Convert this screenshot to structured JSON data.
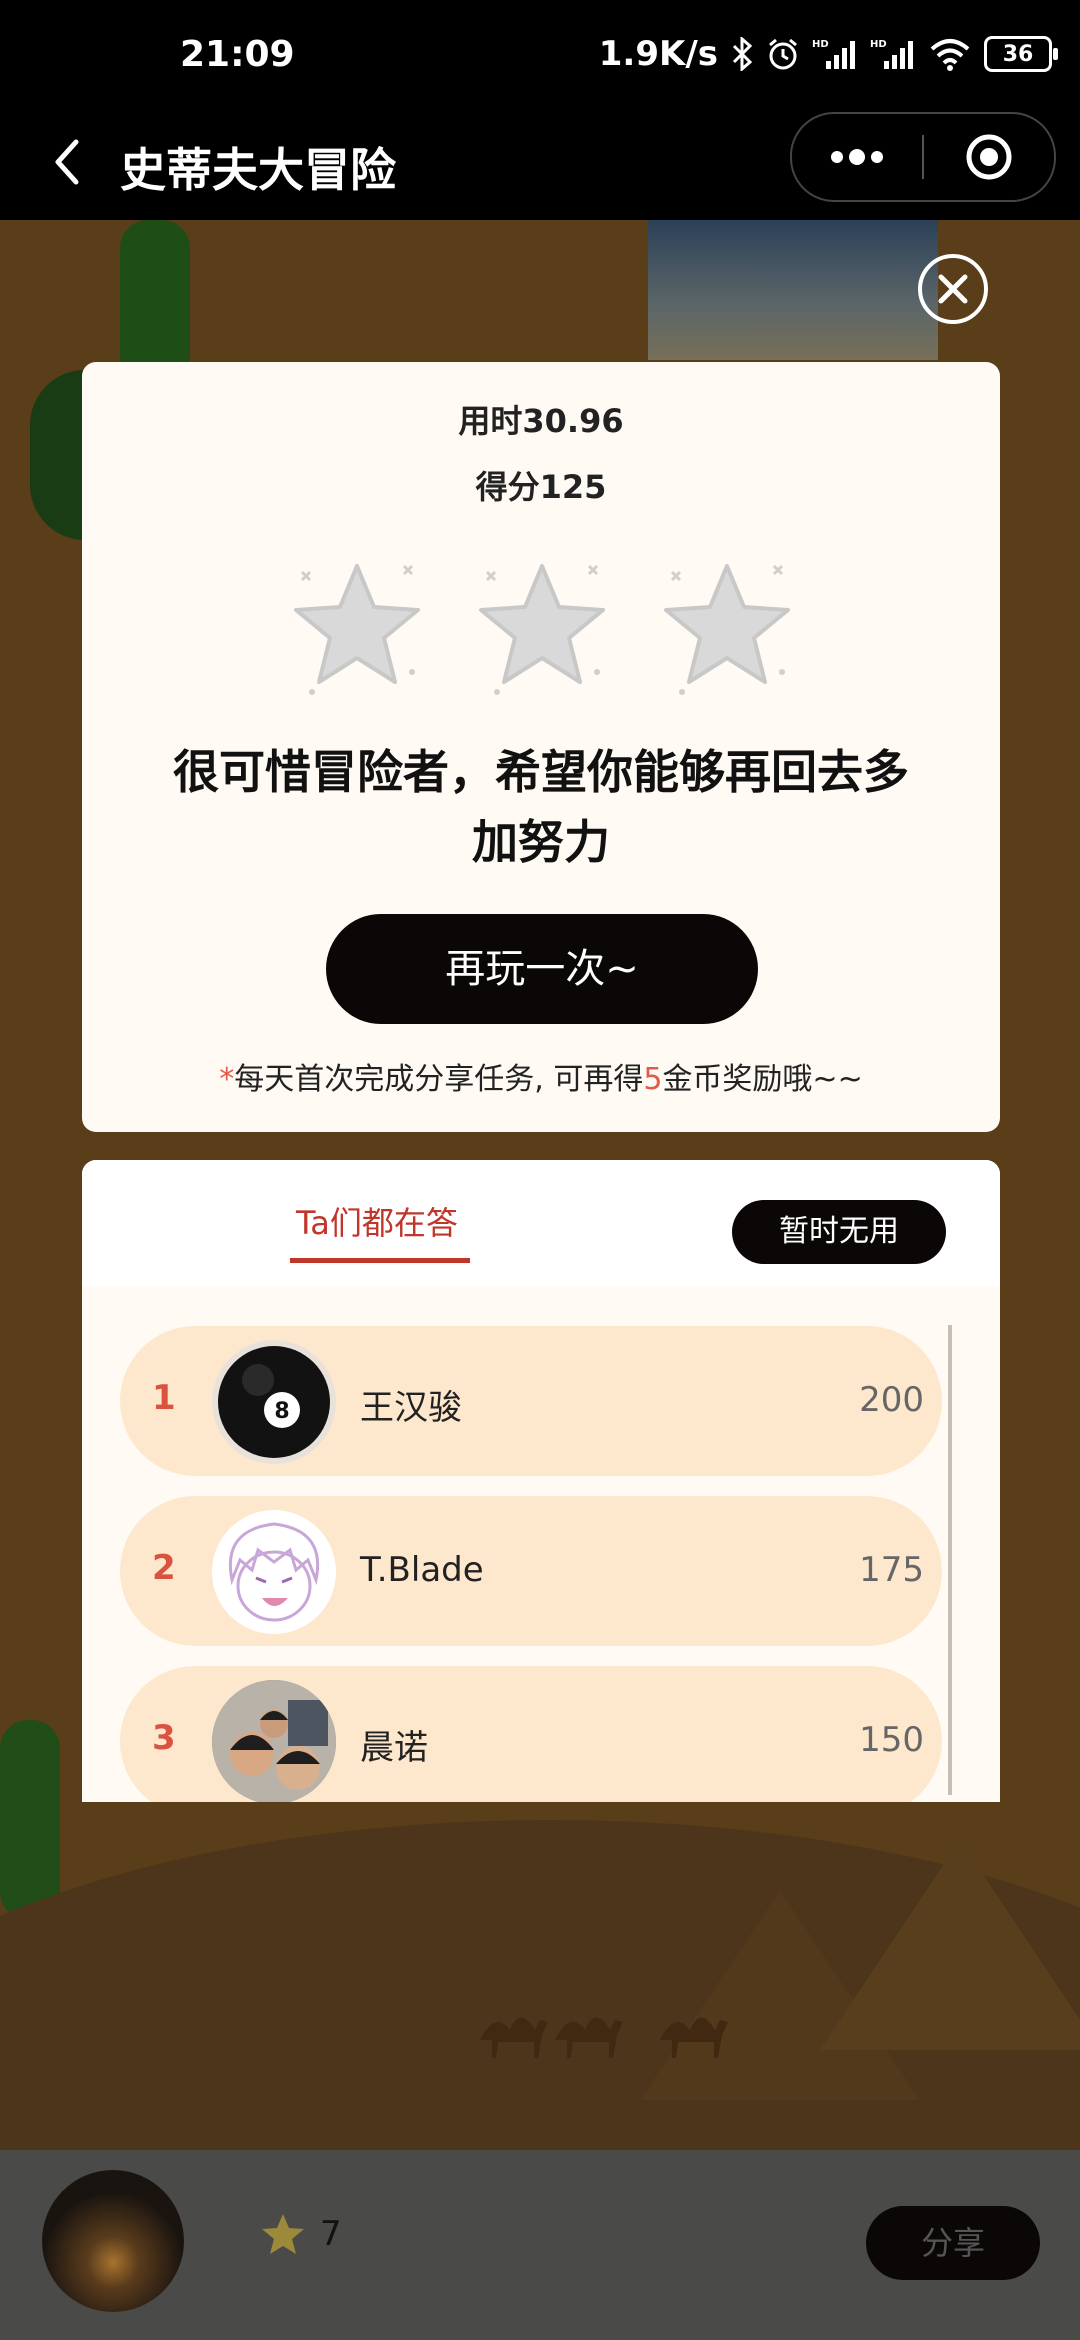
{
  "status_bar": {
    "time": "21:09",
    "network_speed": "1.9K/s",
    "battery": "36",
    "icons": [
      "bluetooth-icon",
      "alarm-icon",
      "signal-hd-icon",
      "signal-hd-icon",
      "wifi-icon",
      "battery-icon"
    ]
  },
  "title_bar": {
    "title": "史蒂夫大冒险",
    "icons": [
      "back-arrow-icon",
      "more-dots-icon",
      "target-circle-icon"
    ]
  },
  "result": {
    "time_used": "用时30.96",
    "score": "得分125",
    "stars_earned": 0,
    "stars_total": 3,
    "message": "很可惜冒险者，希望你能够再回去多加努力",
    "replay_label": "再玩一次~",
    "tip_prefix": "*",
    "tip_part1": "每天首次完成分享任务, 可再得",
    "tip_highlight": "5",
    "tip_part2": "金币奖励哦~~"
  },
  "ranking": {
    "tab_label": "Ta们都在答",
    "temp_button": "暂时无用",
    "rows": [
      {
        "rank": "1",
        "name": "王汉骏",
        "points": "200",
        "avatar": "eight-ball-avatar"
      },
      {
        "rank": "2",
        "name": "T.Blade",
        "points": "175",
        "avatar": "anime-avatar"
      },
      {
        "rank": "3",
        "name": "晨诺",
        "points": "150",
        "avatar": "photo-avatar"
      }
    ]
  },
  "bottom_bar": {
    "coin_count": "7",
    "share_label": "分享"
  },
  "colors": {
    "accent_red": "#c0362a",
    "card_bg": "#fffaf3",
    "row_bg": "#fde8cd",
    "button_dark": "#0c0707"
  }
}
